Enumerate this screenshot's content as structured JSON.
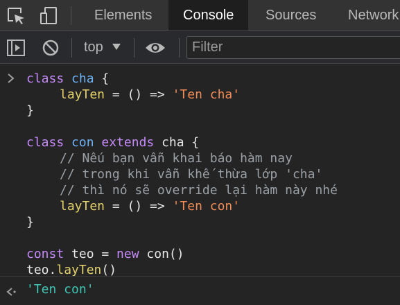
{
  "tabs": [
    {
      "label": "Elements"
    },
    {
      "label": "Console"
    },
    {
      "label": "Sources"
    },
    {
      "label": "Network"
    }
  ],
  "active_tab": "Console",
  "toolbar": {
    "context": "top",
    "filter_placeholder": "Filter",
    "filter_value": ""
  },
  "console": {
    "input_lines": [
      [
        [
          "kw",
          "class"
        ],
        [
          "pun",
          " "
        ],
        [
          "cls",
          "cha"
        ],
        [
          "pun",
          " {"
        ]
      ],
      [
        [
          "ind",
          ""
        ],
        [
          "fn",
          "layTen"
        ],
        [
          "pun",
          " = () => "
        ],
        [
          "str",
          "'Ten cha'"
        ]
      ],
      [
        [
          "pun",
          "}"
        ]
      ],
      [],
      [
        [
          "kw",
          "class"
        ],
        [
          "pun",
          " "
        ],
        [
          "cls",
          "con"
        ],
        [
          "pun",
          " "
        ],
        [
          "kw",
          "extends"
        ],
        [
          "pun",
          " cha {"
        ]
      ],
      [
        [
          "ind",
          ""
        ],
        [
          "cmt",
          "// Nếu bạn vẫn khai báo hàm nay"
        ]
      ],
      [
        [
          "ind",
          ""
        ],
        [
          "cmt",
          "// trong khi vẫn khế thừa lớp 'cha'"
        ]
      ],
      [
        [
          "ind",
          ""
        ],
        [
          "cmt",
          "// thì nó sẽ override lại hàm này nhé"
        ]
      ],
      [
        [
          "ind",
          ""
        ],
        [
          "fn",
          "layTen"
        ],
        [
          "pun",
          " = () => "
        ],
        [
          "str",
          "'Ten con'"
        ]
      ],
      [
        [
          "pun",
          "}"
        ]
      ],
      [],
      [
        [
          "kw",
          "const"
        ],
        [
          "pun",
          " teo = "
        ],
        [
          "kw",
          "new"
        ],
        [
          "pun",
          " con()"
        ]
      ],
      [
        [
          "pun",
          "teo."
        ],
        [
          "fn",
          "layTen"
        ],
        [
          "pun",
          "()"
        ]
      ]
    ],
    "result": "'Ten con'"
  },
  "colors": {
    "keyword": "#c58af9",
    "class_name": "#6fb3f5",
    "function": "#e3d26c",
    "string": "#f28b54",
    "comment": "#9aa0a6",
    "result": "#3fc6b5",
    "background": "#242424"
  },
  "icons": [
    "inspect-element-icon",
    "device-toolbar-icon",
    "sidebar-toggle-icon",
    "clear-console-icon",
    "dropdown-arrow-icon",
    "live-expression-eye-icon",
    "input-chevron-icon",
    "result-arrow-icon"
  ]
}
